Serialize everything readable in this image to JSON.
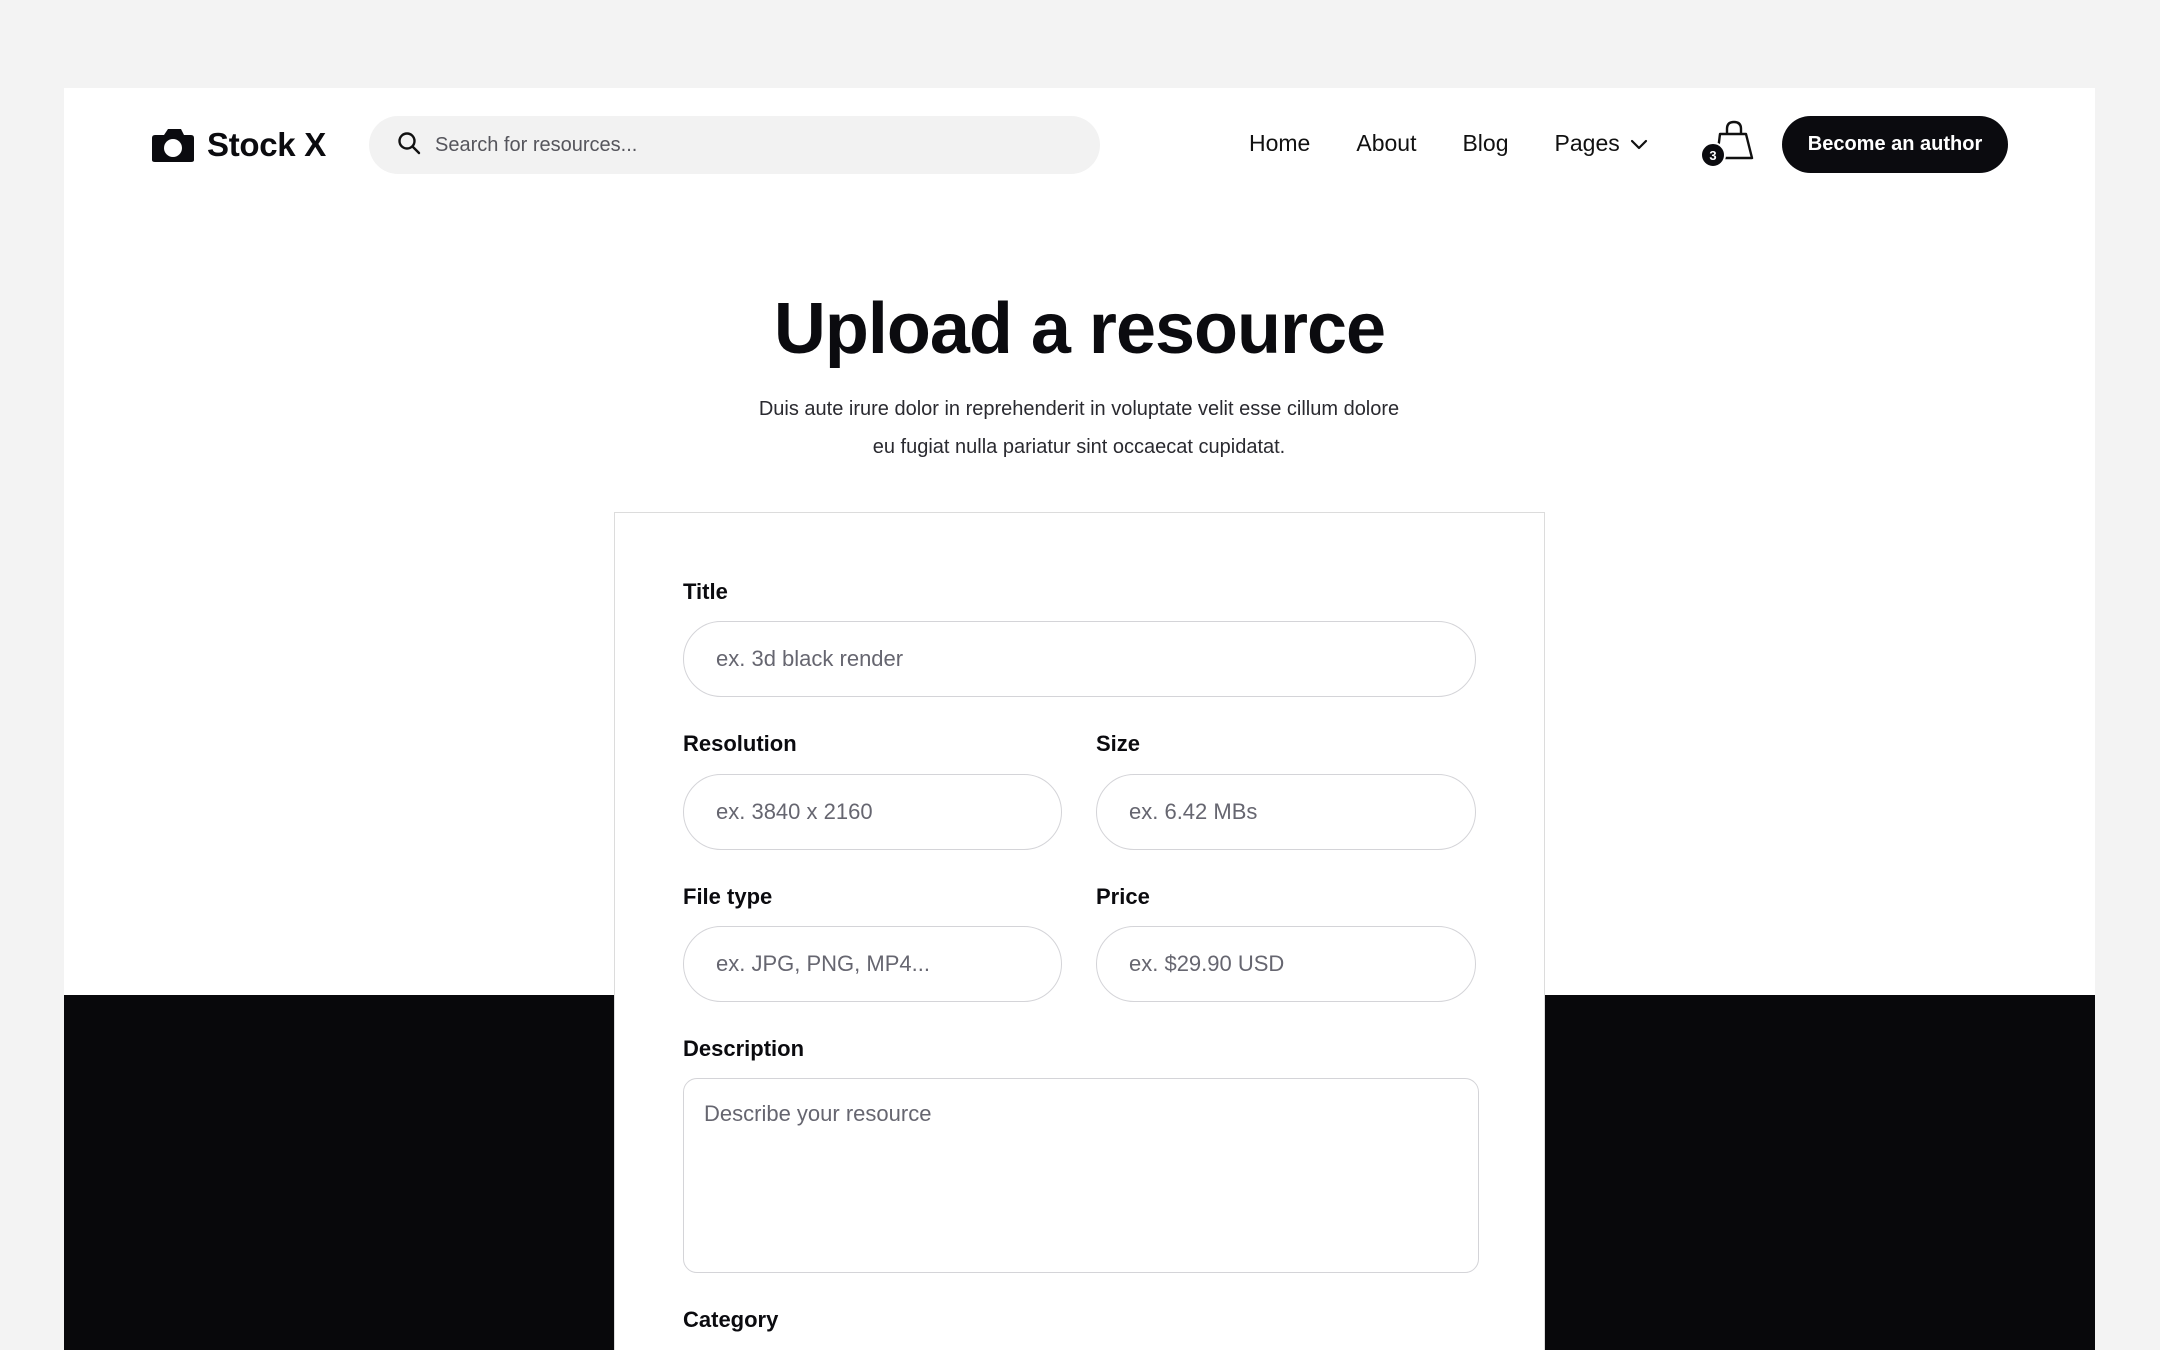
{
  "header": {
    "logo_text": "Stock X",
    "search_placeholder": "Search for resources...",
    "nav": {
      "home": "Home",
      "about": "About",
      "blog": "Blog",
      "pages": "Pages"
    },
    "cart_count": "3",
    "cta_label": "Become an author"
  },
  "hero": {
    "title": "Upload a resource",
    "subtitle_line1": "Duis aute irure dolor in reprehenderit in voluptate velit esse cillum dolore",
    "subtitle_line2": "eu fugiat nulla pariatur sint occaecat cupidatat."
  },
  "form": {
    "title_label": "Title",
    "title_placeholder": "ex. 3d black render",
    "resolution_label": "Resolution",
    "resolution_placeholder": "ex. 3840 x 2160",
    "size_label": "Size",
    "size_placeholder": "ex. 6.42 MBs",
    "filetype_label": "File type",
    "filetype_placeholder": "ex. JPG, PNG, MP4...",
    "price_label": "Price",
    "price_placeholder": "ex. $29.90 USD",
    "description_label": "Description",
    "description_placeholder": "Describe your resource",
    "category_label": "Category"
  },
  "colors": {
    "primary": "#0b0b0f",
    "background": "#f3f3f3",
    "surface": "#ffffff",
    "search_bg": "#f2f2f2",
    "border": "#d4d4d8"
  },
  "icons": {
    "logo": "camera-icon",
    "search": "search-icon",
    "pages_dropdown": "chevron-down-icon",
    "cart": "shopping-bag-icon"
  }
}
